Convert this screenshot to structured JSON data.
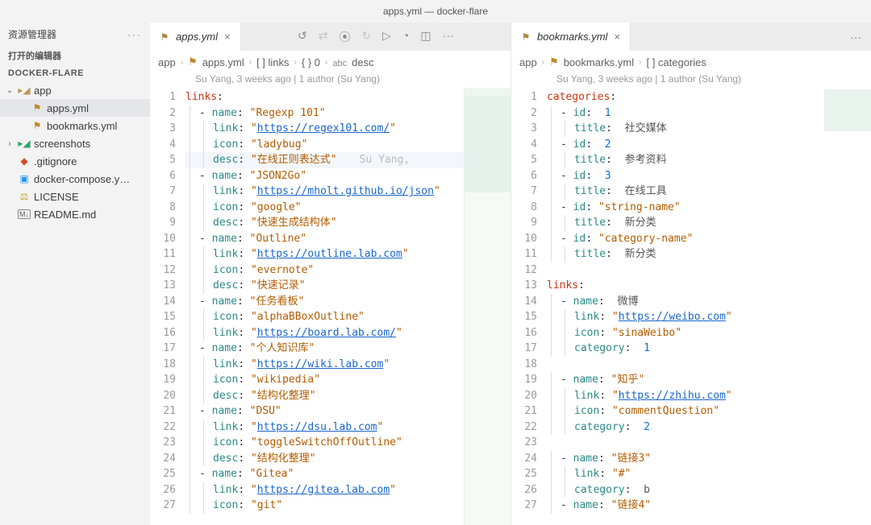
{
  "window_title": "apps.yml — docker-flare",
  "explorer": {
    "title": "资源管理器",
    "open_editors": "打开的编辑器",
    "root": "DOCKER-FLARE",
    "items": [
      {
        "type": "folder",
        "name": "app",
        "open": true,
        "depth": 0
      },
      {
        "type": "file",
        "name": "apps.yml",
        "depth": 1,
        "icon": "yml",
        "selected": true
      },
      {
        "type": "file",
        "name": "bookmarks.yml",
        "depth": 1,
        "icon": "yml"
      },
      {
        "type": "folder",
        "name": "screenshots",
        "open": false,
        "depth": 0,
        "color": "#2aa36a"
      },
      {
        "type": "file",
        "name": ".gitignore",
        "depth": 0,
        "icon": "git"
      },
      {
        "type": "file",
        "name": "docker-compose.y…",
        "depth": 0,
        "icon": "docker"
      },
      {
        "type": "file",
        "name": "LICENSE",
        "depth": 0,
        "icon": "license"
      },
      {
        "type": "file",
        "name": "README.md",
        "depth": 0,
        "icon": "md"
      }
    ]
  },
  "left": {
    "tab_label": "apps.yml",
    "breadcrumb": [
      "app",
      "apps.yml",
      "[ ] links",
      "{ } 0",
      "desc"
    ],
    "annot": "Su Yang, 3 weeks ago | 1 author (Su Yang)",
    "inline_blame": "Su Yang,",
    "lines": [
      {
        "n": 1,
        "t": "root",
        "k": "links"
      },
      {
        "n": 2,
        "t": "kv",
        "key": "name",
        "val": "Regexp 101",
        "dash": true,
        "d": 1
      },
      {
        "n": 3,
        "t": "kv",
        "key": "link",
        "val": "https://regex101.com/",
        "url": true,
        "d": 2
      },
      {
        "n": 4,
        "t": "kv",
        "key": "icon",
        "val": "ladybug",
        "d": 2
      },
      {
        "n": 5,
        "t": "kv",
        "key": "desc",
        "val": "在线正则表达式",
        "d": 2,
        "blame": true,
        "hl": true
      },
      {
        "n": 6,
        "t": "kv",
        "key": "name",
        "val": "JSON2Go",
        "dash": true,
        "d": 1
      },
      {
        "n": 7,
        "t": "kv",
        "key": "link",
        "val": "https://mholt.github.io/json",
        "url": true,
        "d": 2
      },
      {
        "n": 8,
        "t": "kv",
        "key": "icon",
        "val": "google",
        "d": 2
      },
      {
        "n": 9,
        "t": "kv",
        "key": "desc",
        "val": "快速生成结构体",
        "d": 2
      },
      {
        "n": 10,
        "t": "kv",
        "key": "name",
        "val": "Outline",
        "dash": true,
        "d": 1
      },
      {
        "n": 11,
        "t": "kv",
        "key": "link",
        "val": "https://outline.lab.com",
        "url": true,
        "d": 2
      },
      {
        "n": 12,
        "t": "kv",
        "key": "icon",
        "val": "evernote",
        "d": 2
      },
      {
        "n": 13,
        "t": "kv",
        "key": "desc",
        "val": "快速记录",
        "d": 2
      },
      {
        "n": 14,
        "t": "kv",
        "key": "name",
        "val": "任务看板",
        "dash": true,
        "d": 1
      },
      {
        "n": 15,
        "t": "kv",
        "key": "icon",
        "val": "alphaBBoxOutline",
        "d": 2
      },
      {
        "n": 16,
        "t": "kv",
        "key": "link",
        "val": "https://board.lab.com/",
        "url": true,
        "d": 2
      },
      {
        "n": 17,
        "t": "kv",
        "key": "name",
        "val": "个人知识库",
        "dash": true,
        "d": 1
      },
      {
        "n": 18,
        "t": "kv",
        "key": "link",
        "val": "https://wiki.lab.com",
        "url": true,
        "d": 2
      },
      {
        "n": 19,
        "t": "kv",
        "key": "icon",
        "val": "wikipedia",
        "d": 2
      },
      {
        "n": 20,
        "t": "kv",
        "key": "desc",
        "val": "结构化整理",
        "d": 2
      },
      {
        "n": 21,
        "t": "kv",
        "key": "name",
        "val": "DSU",
        "dash": true,
        "d": 1
      },
      {
        "n": 22,
        "t": "kv",
        "key": "link",
        "val": "https://dsu.lab.com",
        "url": true,
        "d": 2
      },
      {
        "n": 23,
        "t": "kv",
        "key": "icon",
        "val": "toggleSwitchOffOutline",
        "d": 2
      },
      {
        "n": 24,
        "t": "kv",
        "key": "desc",
        "val": "结构化整理",
        "d": 2
      },
      {
        "n": 25,
        "t": "kv",
        "key": "name",
        "val": "Gitea",
        "dash": true,
        "d": 1
      },
      {
        "n": 26,
        "t": "kv",
        "key": "link",
        "val": "https://gitea.lab.com",
        "url": true,
        "d": 2
      },
      {
        "n": 27,
        "t": "kv",
        "key": "icon",
        "val": "git",
        "d": 2
      }
    ]
  },
  "right": {
    "tab_label": "bookmarks.yml",
    "breadcrumb": [
      "app",
      "bookmarks.yml",
      "[ ] categories"
    ],
    "annot": "Su Yang, 3 weeks ago | 1 author (Su Yang)",
    "lines": [
      {
        "n": 1,
        "t": "root",
        "k": "categories"
      },
      {
        "n": 2,
        "t": "kvn",
        "key": "id",
        "num": 1,
        "dash": true,
        "d": 1
      },
      {
        "n": 3,
        "t": "kvp",
        "key": "title",
        "plain": "社交媒体",
        "d": 2
      },
      {
        "n": 4,
        "t": "kvn",
        "key": "id",
        "num": 2,
        "dash": true,
        "d": 1
      },
      {
        "n": 5,
        "t": "kvp",
        "key": "title",
        "plain": "参考资料",
        "d": 2
      },
      {
        "n": 6,
        "t": "kvn",
        "key": "id",
        "num": 3,
        "dash": true,
        "d": 1
      },
      {
        "n": 7,
        "t": "kvp",
        "key": "title",
        "plain": "在线工具",
        "d": 2
      },
      {
        "n": 8,
        "t": "kv",
        "key": "id",
        "val": "string-name",
        "dash": true,
        "d": 1
      },
      {
        "n": 9,
        "t": "kvp",
        "key": "title",
        "plain": "新分类",
        "d": 2
      },
      {
        "n": 10,
        "t": "kv",
        "key": "id",
        "val": "category-name",
        "dash": true,
        "d": 1
      },
      {
        "n": 11,
        "t": "kvp",
        "key": "title",
        "plain": "新分类",
        "d": 2
      },
      {
        "n": 12,
        "t": "blank"
      },
      {
        "n": 13,
        "t": "root",
        "k": "links"
      },
      {
        "n": 14,
        "t": "kvp",
        "key": "name",
        "plain": "微博",
        "dash": true,
        "d": 1
      },
      {
        "n": 15,
        "t": "kv",
        "key": "link",
        "val": "https://weibo.com",
        "url": true,
        "d": 2
      },
      {
        "n": 16,
        "t": "kv",
        "key": "icon",
        "val": "sinaWeibo",
        "d": 2
      },
      {
        "n": 17,
        "t": "kvn",
        "key": "category",
        "num": 1,
        "d": 2
      },
      {
        "n": 18,
        "t": "blank"
      },
      {
        "n": 19,
        "t": "kv",
        "key": "name",
        "val": "知乎",
        "dash": true,
        "d": 1
      },
      {
        "n": 20,
        "t": "kv",
        "key": "link",
        "val": "https://zhihu.com",
        "url": true,
        "d": 2
      },
      {
        "n": 21,
        "t": "kv",
        "key": "icon",
        "val": "commentQuestion",
        "d": 2
      },
      {
        "n": 22,
        "t": "kvn",
        "key": "category",
        "num": 2,
        "d": 2
      },
      {
        "n": 23,
        "t": "blank"
      },
      {
        "n": 24,
        "t": "kv",
        "key": "name",
        "val": "链接3",
        "dash": true,
        "d": 1
      },
      {
        "n": 25,
        "t": "kv",
        "key": "link",
        "val": "#",
        "d": 2
      },
      {
        "n": 26,
        "t": "kvp",
        "key": "category",
        "plain": "b",
        "d": 2
      },
      {
        "n": 27,
        "t": "kv",
        "key": "name",
        "val": "链接4",
        "dash": true,
        "d": 1
      }
    ]
  }
}
